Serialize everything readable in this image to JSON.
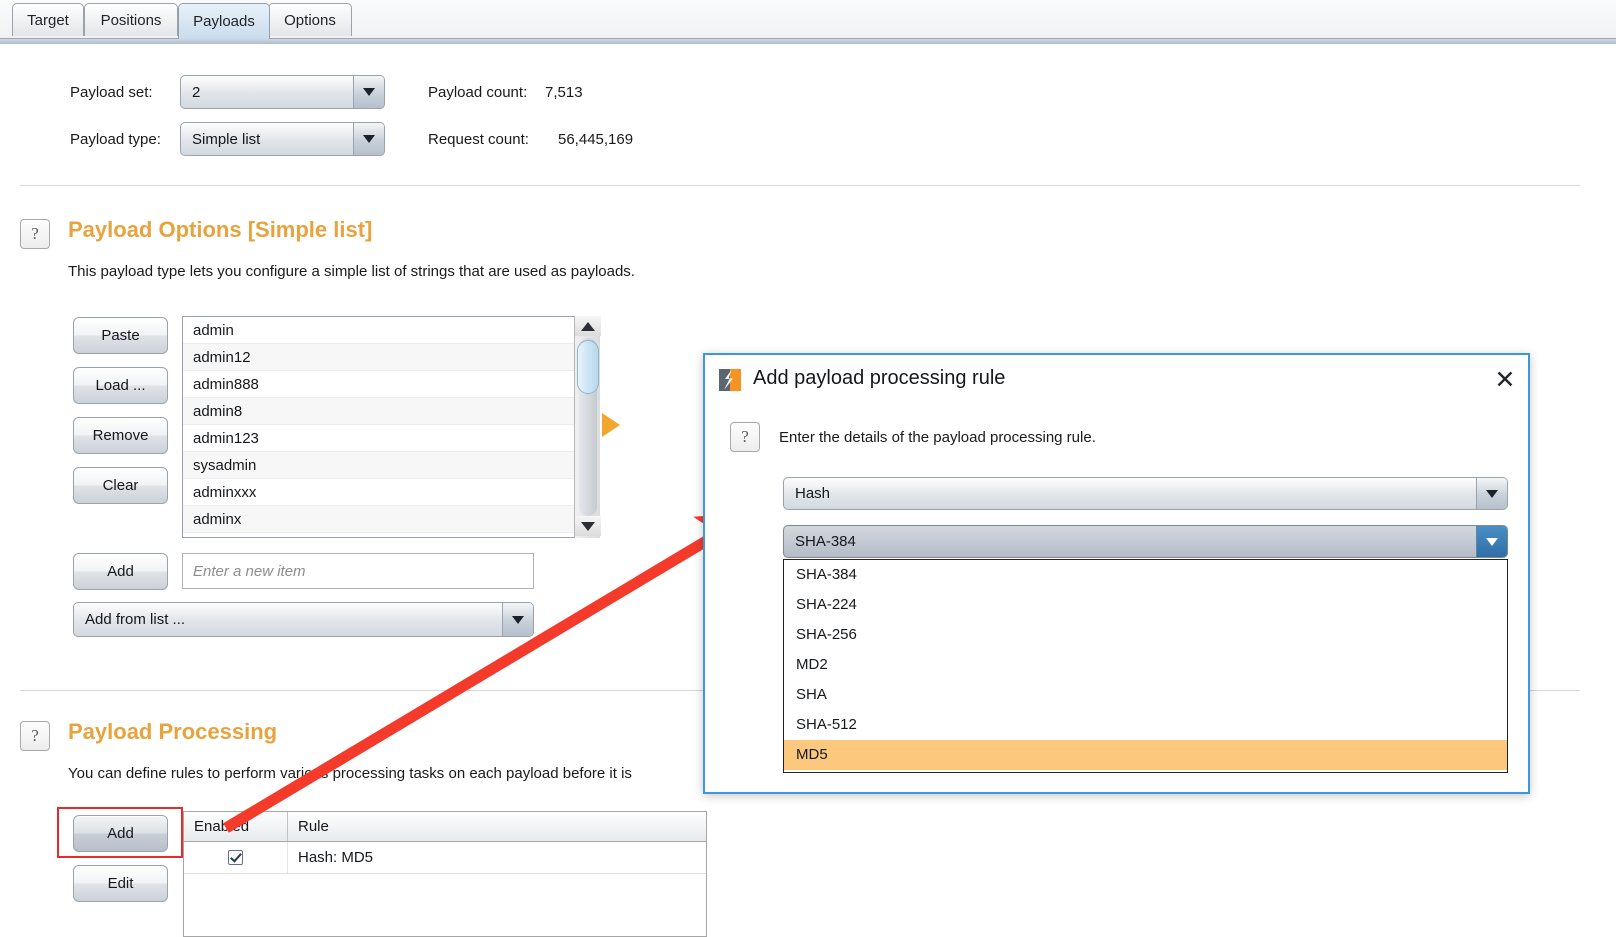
{
  "tabs": [
    {
      "label": "Target",
      "selected": false
    },
    {
      "label": "Positions",
      "selected": false
    },
    {
      "label": "Payloads",
      "selected": true
    },
    {
      "label": "Options",
      "selected": false
    }
  ],
  "top_form": {
    "payload_set_label": "Payload set:",
    "payload_set_value": "2",
    "payload_type_label": "Payload type:",
    "payload_type_value": "Simple list",
    "payload_count_label": "Payload count:",
    "payload_count_value": "7,513",
    "request_count_label": "Request count:",
    "request_count_value": "56,445,169"
  },
  "payload_options": {
    "help_icon": "?",
    "heading": "Payload Options [Simple list]",
    "description": "This payload type lets you configure a simple list of strings that are used as payloads.",
    "buttons": [
      "Paste",
      "Load ...",
      "Remove",
      "Clear"
    ],
    "list_items": [
      "admin",
      "admin12",
      "admin888",
      "admin8",
      "admin123",
      "sysadmin",
      "adminxxx",
      "adminx"
    ],
    "add_button": "Add",
    "add_input_placeholder": "Enter a new item",
    "add_from_list_value": "Add from list ...",
    "play_icon": "play-triangle-icon"
  },
  "payload_processing": {
    "help_icon": "?",
    "heading": "Payload Processing",
    "description": "You can define rules to perform various processing tasks on each payload before it is",
    "buttons": [
      "Add",
      "Edit"
    ],
    "table": {
      "headers": [
        "Enabled",
        "Rule"
      ],
      "rows": [
        {
          "enabled": true,
          "rule": "Hash: MD5"
        }
      ]
    }
  },
  "dialog": {
    "icon": "burp-logo-icon",
    "title": "Add payload processing rule",
    "close_label": "✕",
    "help_icon": "?",
    "description": "Enter the details of the payload processing rule.",
    "rule_type_value": "Hash",
    "algorithm_value": "SHA-384",
    "algorithm_options": [
      {
        "label": "SHA-384",
        "highlighted": false
      },
      {
        "label": "SHA-224",
        "highlighted": false
      },
      {
        "label": "SHA-256",
        "highlighted": false
      },
      {
        "label": "MD2",
        "highlighted": false
      },
      {
        "label": "SHA",
        "highlighted": false
      },
      {
        "label": "SHA-512",
        "highlighted": false
      },
      {
        "label": "MD5",
        "highlighted": true
      }
    ]
  },
  "annotations": {
    "arrow_color": "#f33a2b",
    "highlight_box_color": "#e62b2b"
  },
  "colors": {
    "accent_orange": "#e8a33d",
    "dialog_border_blue": "#3e97d8",
    "selection_orange": "#fcc87d",
    "play_orange": "#f2a72c"
  }
}
